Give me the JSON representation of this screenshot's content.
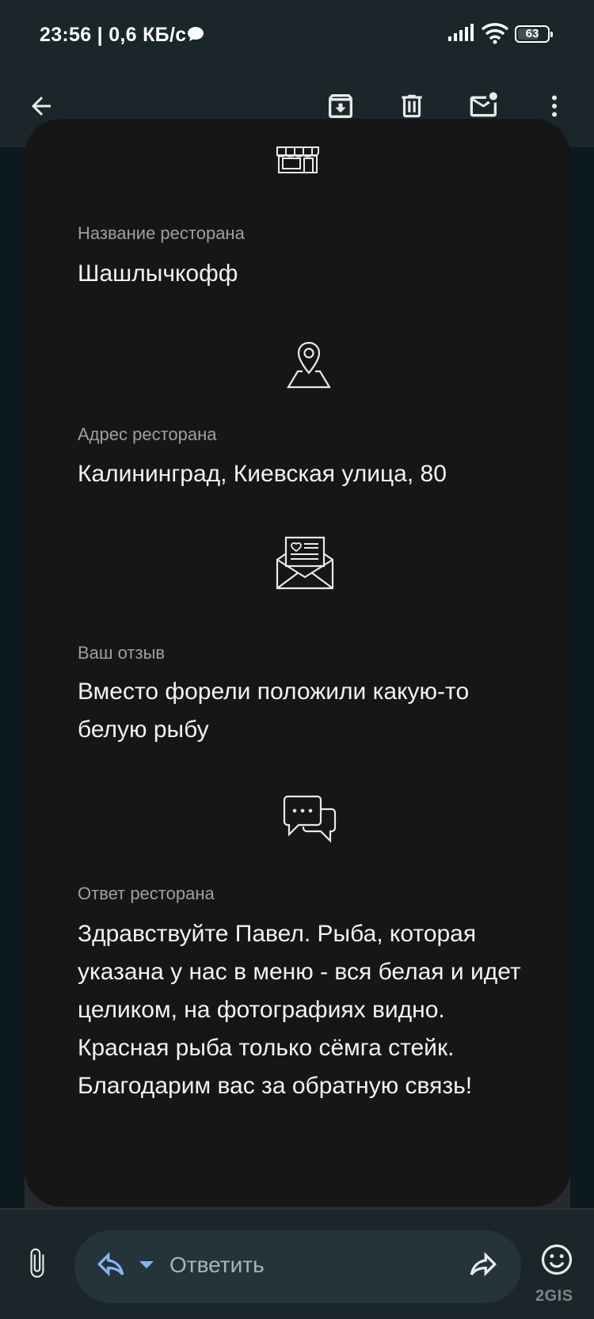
{
  "status_bar": {
    "time": "23:56 | 0,6 КБ/с",
    "battery": "63"
  },
  "sections": [
    {
      "icon": "storefront-icon",
      "label": "Название ресторана",
      "value": "Шашлычкофф"
    },
    {
      "icon": "map-pin-icon",
      "label": "Адрес ресторана",
      "value": "Калининград, Киевская улица, 80"
    },
    {
      "icon": "love-letter-icon",
      "label": "Ваш отзыв",
      "value": "Вместо форели положили какую-то белую рыбу"
    },
    {
      "icon": "chat-bubbles-icon",
      "label": "Ответ ресторана",
      "value": "Здравствуйте Павел. Рыба, которая указана у нас в меню - вся белая и идет целиком, на фотографиях видно. Красная рыба только сёмга стейк. Благодарим вас за обратную связь!"
    }
  ],
  "reply_bar": {
    "reply_placeholder": "Ответить"
  },
  "watermark": "2GIS"
}
